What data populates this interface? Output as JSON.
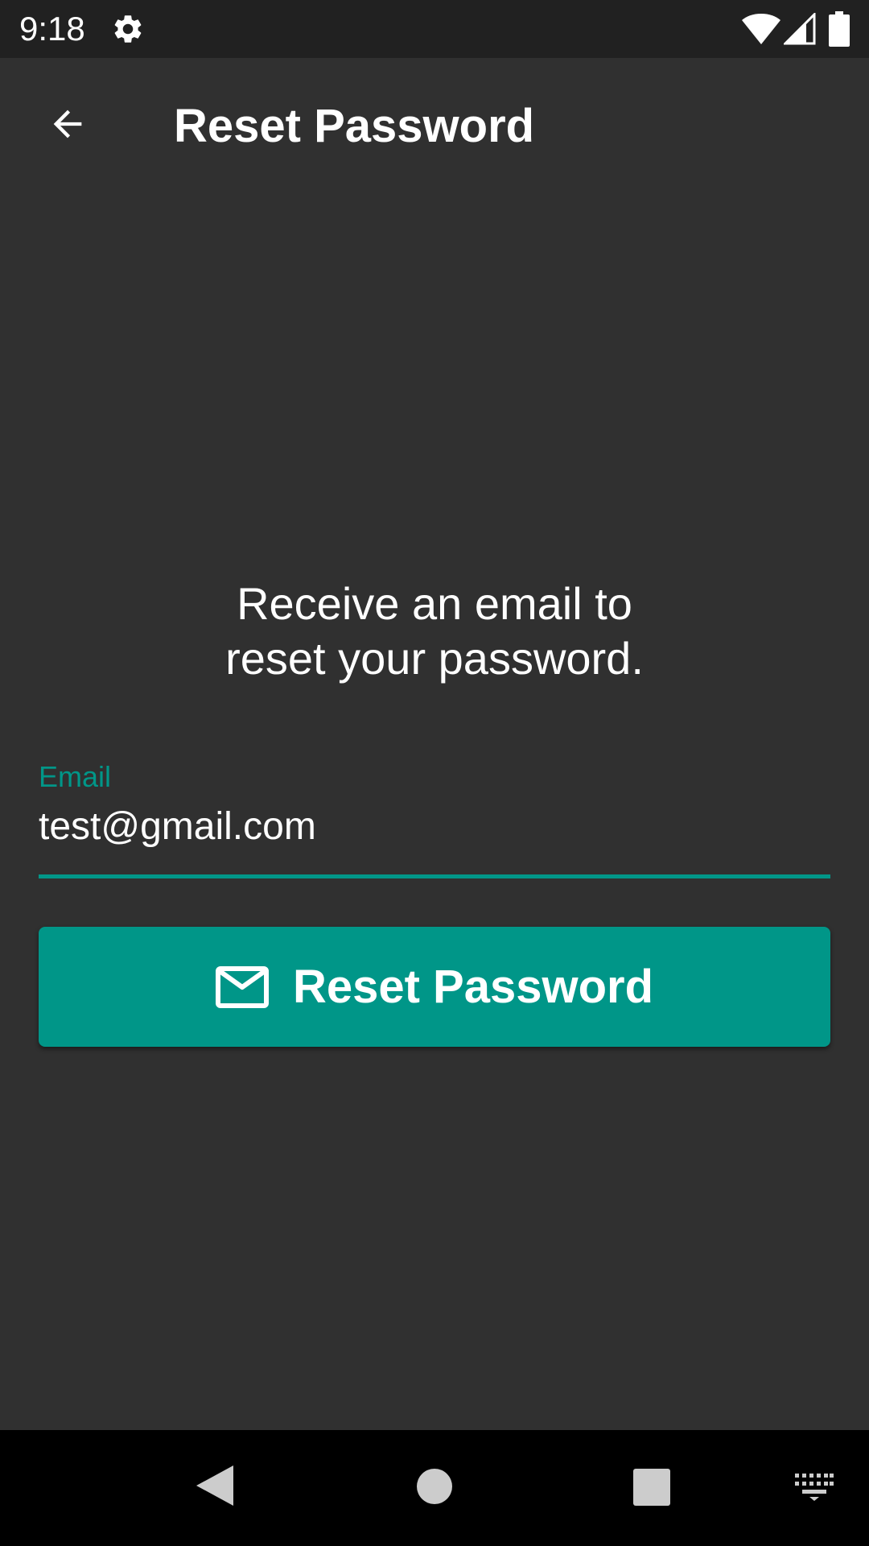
{
  "status_bar": {
    "time": "9:18",
    "icons": [
      "gear-icon",
      "wifi-icon",
      "signal-icon",
      "battery-icon"
    ]
  },
  "app_bar": {
    "back_icon": "arrow-back-icon",
    "title": "Reset Password"
  },
  "description": {
    "line1": "Receive an email to",
    "line2": "reset your password."
  },
  "email_field": {
    "label": "Email",
    "value": "test@gmail.com"
  },
  "reset_button": {
    "icon": "mail-icon",
    "label": "Reset Password"
  },
  "nav_bar": {
    "icons": [
      "nav-back-icon",
      "nav-home-icon",
      "nav-recents-icon",
      "keyboard-icon"
    ]
  },
  "colors": {
    "background": "#303030",
    "status_bar": "#212121",
    "accent": "#009688",
    "nav_bar": "#000000",
    "text": "#ffffff"
  }
}
